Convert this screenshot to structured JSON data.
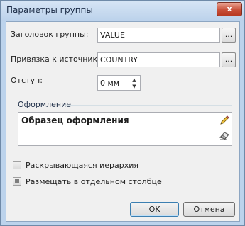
{
  "dialog": {
    "title": "Параметры группы",
    "close_label": "x"
  },
  "fields": {
    "group_header_label": "Заголовок группы:",
    "group_header_value": "VALUE",
    "source_binding_label": "Привязка к источнику:",
    "source_binding_value": "COUNTRY",
    "browse_label": "...",
    "indent_label": "Отступ:",
    "indent_value": "0 мм"
  },
  "appearance": {
    "section_title": "Оформление",
    "sample_text": "Образец оформления"
  },
  "options": {
    "expandable_hierarchy": {
      "label": "Раскрывающаяся иерархия",
      "checked": false
    },
    "separate_column": {
      "label": "Размещать в отдельном столбце",
      "checked": false
    }
  },
  "buttons": {
    "ok": "OK",
    "cancel": "Отмена"
  },
  "icons": {
    "edit": "pencil-icon",
    "clear": "eraser-icon",
    "spin_up": "chevron-up-icon",
    "spin_down": "chevron-down-icon"
  }
}
